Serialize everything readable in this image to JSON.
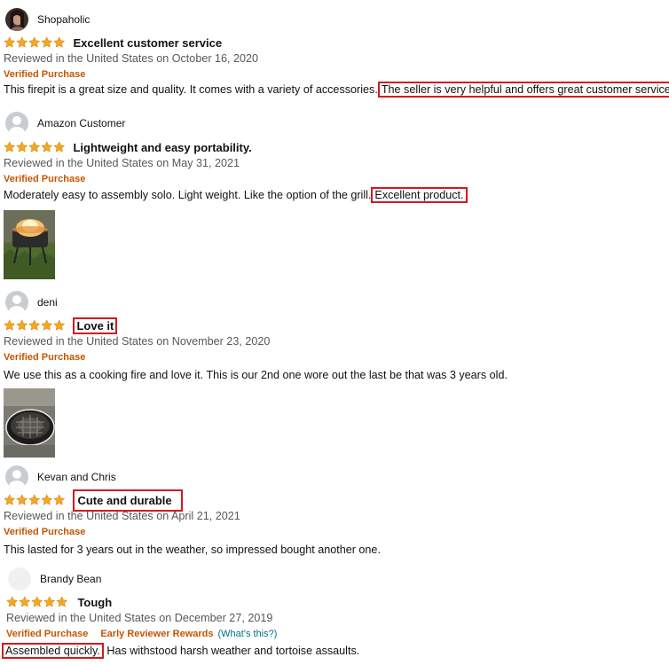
{
  "reviews": [
    {
      "author": "Shopaholic",
      "avatar": "profile-photo",
      "rating": 5,
      "title": "Excellent customer service",
      "date": "Reviewed in the United States on October 16, 2020",
      "verified": "Verified Purchase",
      "body_plain": "This firepit is a great size and quality. It comes with a variety of accessories.",
      "body_highlight": "The seller is very helpful and offers great customer service."
    },
    {
      "author": "Amazon Customer",
      "avatar": "default-profile-icon",
      "rating": 5,
      "title": "Lightweight and easy portability.",
      "date": "Reviewed in the United States on May 31, 2021",
      "verified": "Verified Purchase",
      "body_plain": "Moderately easy to assembly solo. Light weight. Like the option of the grill.",
      "body_highlight": "Excellent product.",
      "photo": "fire-pit-flames-photo"
    },
    {
      "author": "deni",
      "avatar": "default-profile-icon",
      "rating": 5,
      "title": "Love it",
      "date": "Reviewed in the United States on November 23, 2020",
      "verified": "Verified Purchase",
      "body": "We use this as a cooking fire and love it. This is our 2nd one wore out the last be that was 3 years old.",
      "photo": "fire-pit-grill-photo"
    },
    {
      "author": "Kevan and Chris",
      "avatar": "default-profile-icon",
      "rating": 5,
      "title": "Cute and durable",
      "date": "Reviewed in the United States on April 21, 2021",
      "verified": "Verified Purchase",
      "body": "This lasted for 3 years out in the weather, so impressed bought another one."
    },
    {
      "author": "Brandy Bean",
      "avatar": "blank-profile-icon",
      "rating": 5,
      "title": "Tough",
      "date": "Reviewed in the United States on December 27, 2019",
      "verified": "Verified Purchase",
      "early_reviewer": "Early Reviewer Rewards",
      "whats_this": "(What's this?)",
      "body_highlight": "Assembled quickly.",
      "body_plain": "Has withstood harsh weather and tortoise assaults."
    }
  ],
  "colors": {
    "star": "#f5a623",
    "verified": "#c45500",
    "highlight_box": "#d6181d",
    "link": "#007185",
    "date": "#565959"
  }
}
